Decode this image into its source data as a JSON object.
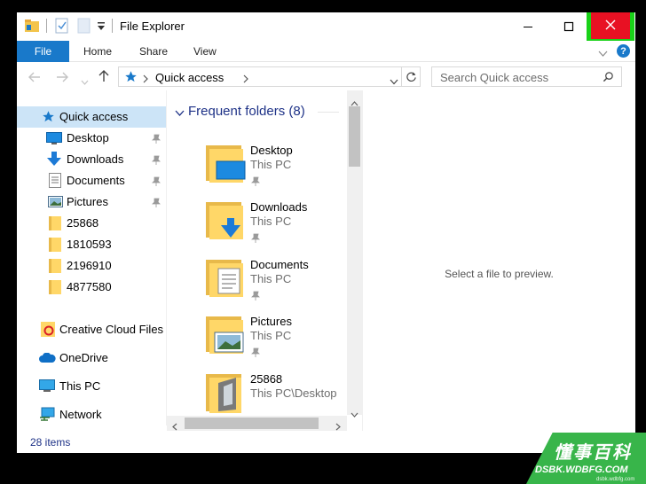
{
  "window": {
    "title": "File Explorer"
  },
  "ribbon": {
    "file_tab": "File",
    "tabs": [
      "Home",
      "Share",
      "View"
    ]
  },
  "address": {
    "crumbs": "Quick access",
    "search_placeholder": "Search Quick access"
  },
  "sidebar": {
    "quick_access": "Quick access",
    "items": [
      {
        "label": "Desktop",
        "icon": "desktop-icon",
        "pinned": true
      },
      {
        "label": "Downloads",
        "icon": "downloads-icon",
        "pinned": true
      },
      {
        "label": "Documents",
        "icon": "documents-icon",
        "pinned": true
      },
      {
        "label": "Pictures",
        "icon": "pictures-icon",
        "pinned": true
      },
      {
        "label": "25868",
        "icon": "folder-icon",
        "pinned": false
      },
      {
        "label": "1810593",
        "icon": "folder-icon",
        "pinned": false
      },
      {
        "label": "2196910",
        "icon": "folder-icon",
        "pinned": false
      },
      {
        "label": "4877580",
        "icon": "folder-icon",
        "pinned": false
      }
    ],
    "roots": [
      {
        "label": "Creative Cloud Files",
        "icon": "creative-cloud-icon"
      },
      {
        "label": "OneDrive",
        "icon": "onedrive-icon"
      },
      {
        "label": "This PC",
        "icon": "this-pc-icon"
      },
      {
        "label": "Network",
        "icon": "network-icon"
      }
    ]
  },
  "content": {
    "section_title": "Frequent folders (8)",
    "folders": [
      {
        "name": "Desktop",
        "location": "This PC"
      },
      {
        "name": "Downloads",
        "location": "This PC"
      },
      {
        "name": "Documents",
        "location": "This PC"
      },
      {
        "name": "Pictures",
        "location": "This PC"
      },
      {
        "name": "25868",
        "location": "This PC\\Desktop"
      }
    ]
  },
  "preview": {
    "message": "Select a file to preview."
  },
  "status": {
    "items": "28 items"
  },
  "watermark": {
    "main": "懂事百科",
    "site": "DSBK.WDBFG.COM",
    "tiny": "dsbk.wdbfg.com"
  },
  "colors": {
    "accent": "#1979ca",
    "close_red": "#e81123",
    "highlight_green": "#19d219",
    "selection": "#cce4f7"
  }
}
